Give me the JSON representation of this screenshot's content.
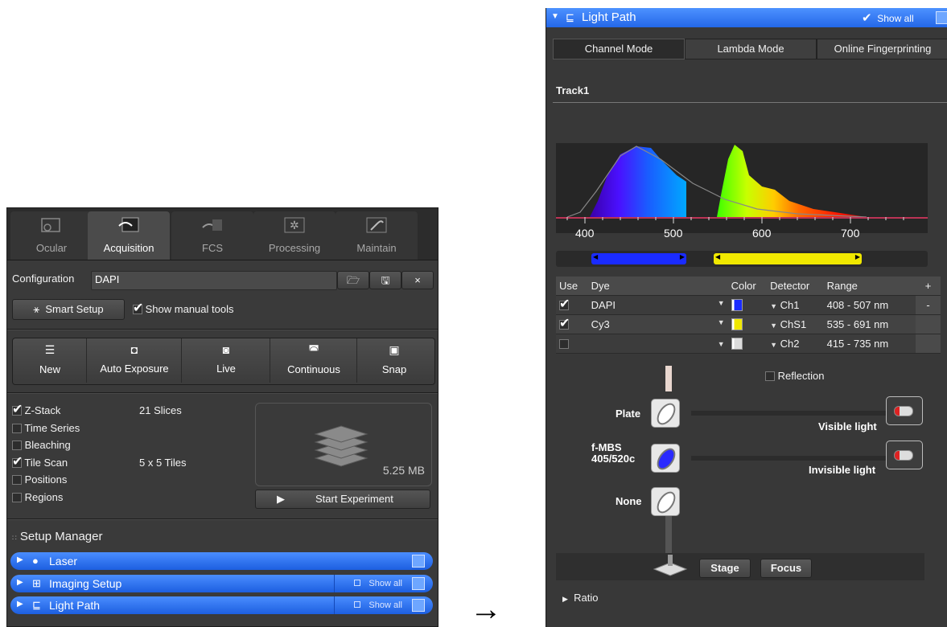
{
  "left_panel": {
    "tabs": [
      {
        "label": "Ocular",
        "icon": "ocular-icon"
      },
      {
        "label": "Acquisition",
        "icon": "acquisition-icon"
      },
      {
        "label": "FCS",
        "icon": "fcs-icon"
      },
      {
        "label": "Processing",
        "icon": "processing-icon"
      },
      {
        "label": "Maintain",
        "icon": "maintain-icon"
      }
    ],
    "active_tab": "Acquisition",
    "configuration": {
      "label": "Configuration",
      "value": "DAPI"
    },
    "smart_setup_label": "Smart Setup",
    "show_manual_tools_label": "Show manual tools",
    "show_manual_tools_checked": true,
    "actions": [
      {
        "label": "New",
        "icon": "new-icon"
      },
      {
        "label": "Auto Exposure",
        "icon": "camera-icon"
      },
      {
        "label": "Live",
        "icon": "live-icon"
      },
      {
        "label": "Continuous",
        "icon": "continuous-icon"
      },
      {
        "label": "Snap",
        "icon": "snap-icon"
      }
    ],
    "experiment_options": [
      {
        "label": "Z-Stack",
        "checked": true,
        "detail": "21 Slices"
      },
      {
        "label": "Time Series",
        "checked": false,
        "detail": ""
      },
      {
        "label": "Bleaching",
        "checked": false,
        "detail": ""
      },
      {
        "label": "Tile Scan",
        "checked": true,
        "detail": "5 x 5 Tiles"
      },
      {
        "label": "Positions",
        "checked": false,
        "detail": ""
      },
      {
        "label": "Regions",
        "checked": false,
        "detail": ""
      }
    ],
    "data_size": "5.25 MB",
    "start_experiment_label": "Start Experiment",
    "setup_manager_title": "Setup Manager",
    "tool_bars": [
      {
        "label": "Laser",
        "icon": "bulb-icon",
        "show_all": ""
      },
      {
        "label": "Imaging Setup",
        "icon": "grid-icon",
        "show_all": "Show all"
      },
      {
        "label": "Light Path",
        "icon": "light-path-icon",
        "show_all": "Show all"
      }
    ]
  },
  "right_panel": {
    "title": "Light Path",
    "show_all_label": "Show all",
    "show_all_checked": true,
    "modes": [
      "Channel Mode",
      "Lambda Mode",
      "Online Fingerprinting"
    ],
    "active_mode": "Channel Mode",
    "track_label": "Track1",
    "spectrum_ticks": [
      "400",
      "500",
      "600",
      "700"
    ],
    "table_headers": [
      "Use",
      "Dye",
      "Color",
      "Detector",
      "Range"
    ],
    "add_label": "+",
    "remove_label": "-",
    "channels": [
      {
        "use": true,
        "dye": "DAPI",
        "color": "#1a2bff",
        "detector": "Ch1",
        "range": "408 - 507 nm"
      },
      {
        "use": true,
        "dye": "Cy3",
        "color": "#f0e800",
        "detector": "ChS1",
        "range": "535 - 691 nm"
      },
      {
        "use": false,
        "dye": "",
        "color": "#dddddd",
        "detector": "Ch2",
        "range": "415 - 735 nm"
      }
    ],
    "reflection_label": "Reflection",
    "reflection_checked": false,
    "beam_elements": [
      {
        "label": "Plate"
      },
      {
        "label": "f-MBS\n405/520c"
      },
      {
        "label": "None"
      }
    ],
    "visible_light_label": "Visible light",
    "invisible_light_label": "Invisible light",
    "stage_label": "Stage",
    "focus_label": "Focus",
    "ratio_label": "Ratio"
  },
  "arrow_glyph": "→"
}
